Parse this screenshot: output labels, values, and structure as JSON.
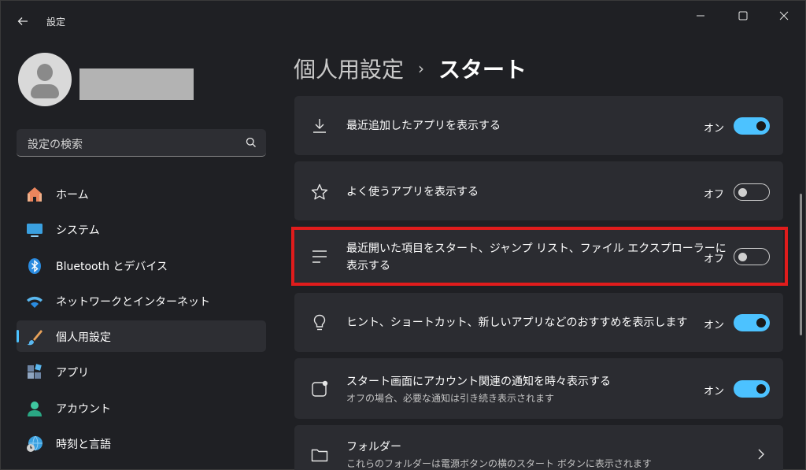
{
  "window": {
    "title": "設定"
  },
  "sidebar": {
    "search_placeholder": "設定の検索",
    "items": [
      {
        "label": "ホーム",
        "icon": "home-icon"
      },
      {
        "label": "システム",
        "icon": "monitor-icon"
      },
      {
        "label": "Bluetooth とデバイス",
        "icon": "bluetooth-icon"
      },
      {
        "label": "ネットワークとインターネット",
        "icon": "wifi-icon"
      },
      {
        "label": "個人用設定",
        "icon": "brush-icon",
        "active": true
      },
      {
        "label": "アプリ",
        "icon": "apps-icon"
      },
      {
        "label": "アカウント",
        "icon": "account-icon"
      },
      {
        "label": "時刻と言語",
        "icon": "globe-clock-icon"
      }
    ]
  },
  "breadcrumb": {
    "parent": "個人用設定",
    "separator": "›",
    "current": "スタート"
  },
  "settings": [
    {
      "title": "最近追加したアプリを表示する",
      "state": "オン",
      "on": true,
      "icon": "download-icon"
    },
    {
      "title": "よく使うアプリを表示する",
      "state": "オフ",
      "on": false,
      "icon": "star-icon"
    },
    {
      "title_line1": "最近開いた項目をスタート、ジャンプ リスト、ファイル エクスプローラーに",
      "title_line2": "表示する",
      "state": "オフ",
      "on": false,
      "icon": "list-icon",
      "highlighted": true
    },
    {
      "title": "ヒント、ショートカット、新しいアプリなどのおすすめを表示します",
      "state": "オン",
      "on": true,
      "icon": "lightbulb-icon"
    },
    {
      "title": "スタート画面にアカウント関連の通知を時々表示する",
      "subtitle": "オフの場合、必要な通知は引き続き表示されます",
      "state": "オン",
      "on": true,
      "icon": "notification-icon"
    },
    {
      "title": "フォルダー",
      "subtitle": "これらのフォルダーは電源ボタンの横のスタート ボタンに表示されます",
      "icon": "folder-icon"
    }
  ],
  "colors": {
    "accent": "#4cc2ff",
    "highlight": "#e01c1c"
  }
}
